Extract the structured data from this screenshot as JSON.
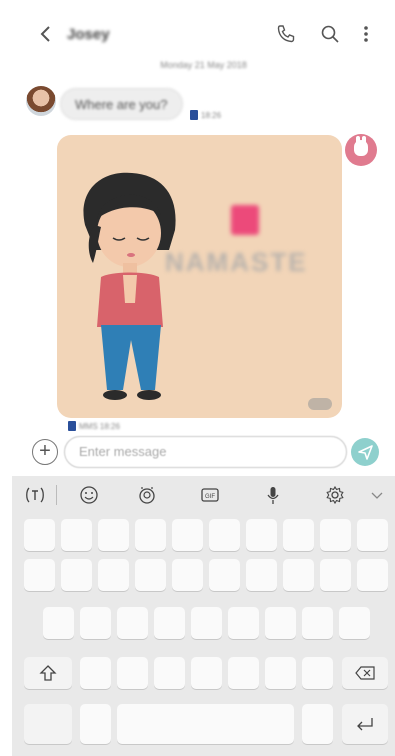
{
  "header": {
    "title": "Josey",
    "back_icon": "chevron-left-icon",
    "call_icon": "phone-icon",
    "search_icon": "search-icon",
    "menu_icon": "more-vertical-icon"
  },
  "thread": {
    "date": "Monday 21 May 2018",
    "incoming": {
      "text": "Where are you?",
      "time": "18:26"
    },
    "outgoing_sticker": {
      "text": "NAMASTE",
      "meta": "MMS 18:26"
    }
  },
  "composer": {
    "placeholder": "Enter message"
  },
  "keyboard_toolbar": {
    "items": [
      "text-mode-icon",
      "emoji-icon",
      "sticker-icon",
      "gif-icon",
      "mic-icon",
      "settings-icon",
      "collapse-icon"
    ],
    "gif_label": "GIF"
  },
  "colors": {
    "accent": "#8ed0cd",
    "sim_badge": "#2a4f9a",
    "sticker_bg": "#f2d5b8"
  }
}
